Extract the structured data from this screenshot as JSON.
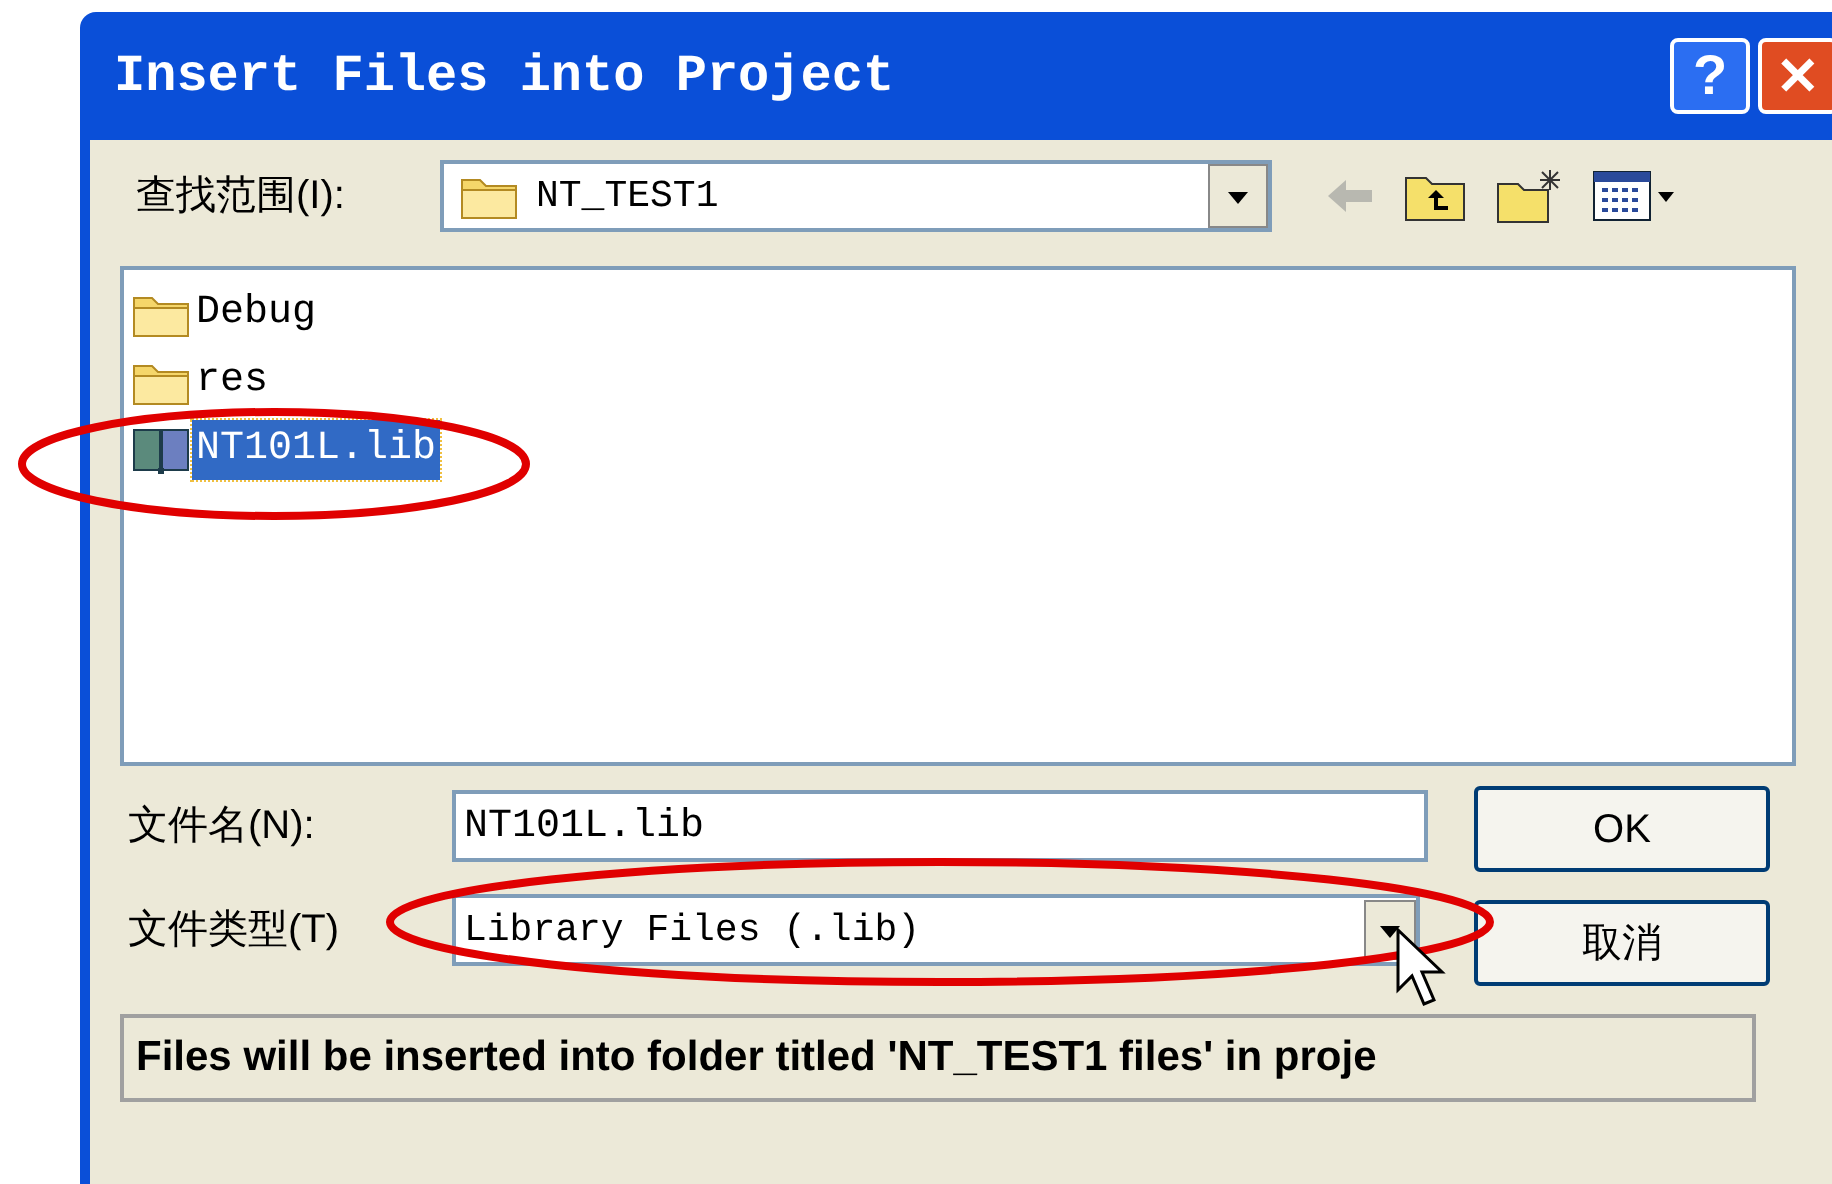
{
  "window": {
    "title": "Insert Files into Project",
    "title_buttons": [
      "?",
      "✕"
    ]
  },
  "look_in": {
    "label": "查找范围(I):",
    "value": "NT_TEST1"
  },
  "files": [
    {
      "name": "Debug",
      "kind": "folder",
      "selected": false
    },
    {
      "name": "res",
      "kind": "folder",
      "selected": false
    },
    {
      "name": "NT101L.lib",
      "kind": "library",
      "selected": true
    }
  ],
  "file_name": {
    "label": "文件名(N):",
    "value": "NT101L.lib"
  },
  "file_type": {
    "label": "文件类型(T)",
    "value": "Library Files (.lib)"
  },
  "buttons": [
    "OK",
    "取消"
  ],
  "status": "Files will be inserted into folder titled 'NT_TEST1 files' in proje"
}
